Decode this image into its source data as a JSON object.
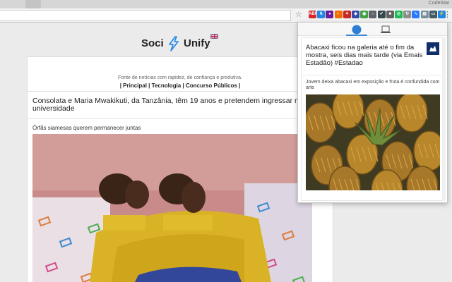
{
  "browser": {
    "profile_name": "CodeStat",
    "extensions": [
      {
        "name": "adblock-icon",
        "label": "ABP",
        "color": "#d7262a"
      },
      {
        "name": "ext-arrow-icon",
        "label": "↯",
        "color": "#1e88e5"
      },
      {
        "name": "ext-puzzle-icon",
        "label": "●",
        "color": "#6a1b9a"
      },
      {
        "name": "ext-fox-icon",
        "label": "◐",
        "color": "#ef6c00"
      },
      {
        "name": "ext-star-icon",
        "label": "✦",
        "color": "#c62828"
      },
      {
        "name": "ext-diamond-icon",
        "label": "◆",
        "color": "#3949ab"
      },
      {
        "name": "ext-chrome-icon",
        "label": "◉",
        "color": "#43a047"
      },
      {
        "name": "ext-circle-icon",
        "label": "○",
        "color": "#5f6368"
      },
      {
        "name": "ext-check-icon",
        "label": "✔",
        "color": "#37474f"
      },
      {
        "name": "ext-box-icon",
        "label": "■",
        "color": "#616161"
      },
      {
        "name": "ext-spotify-icon",
        "label": "◎",
        "color": "#1db954"
      },
      {
        "name": "ext-refresh-icon",
        "label": "↻",
        "color": "#8d8d8d"
      },
      {
        "name": "ext-wave-icon",
        "label": "∿",
        "color": "#2979ff"
      },
      {
        "name": "ext-doc-icon",
        "label": "▤",
        "color": "#78909c"
      },
      {
        "name": "ext-cast-icon",
        "label": "▭",
        "color": "#455a64"
      },
      {
        "name": "ext-sociunify-icon",
        "label": "⚡",
        "color": "#1e88e5"
      }
    ]
  },
  "site": {
    "logo_left": "Soci",
    "logo_right": "Unify",
    "tagline": "Fonte de notícias com rapidez, de confiança e produtiva.",
    "nav_links": "| Principal | Tecnologia | Concurso Públicos |"
  },
  "article": {
    "title": "Consolata e Maria Mwakikuti, da Tanzânia, têm 19 anos e pretendem ingressar na universidade",
    "caption": "Órfãs siamesas querem permanecer juntas"
  },
  "popup": {
    "post_title": "Abacaxi ficou na galeria até o fim da mostra, seis dias mais tarde (via Emais Estadão) #Estadao",
    "post_description": "Jovem deixa abacaxi em exposição e fruta é confundida com arte"
  }
}
